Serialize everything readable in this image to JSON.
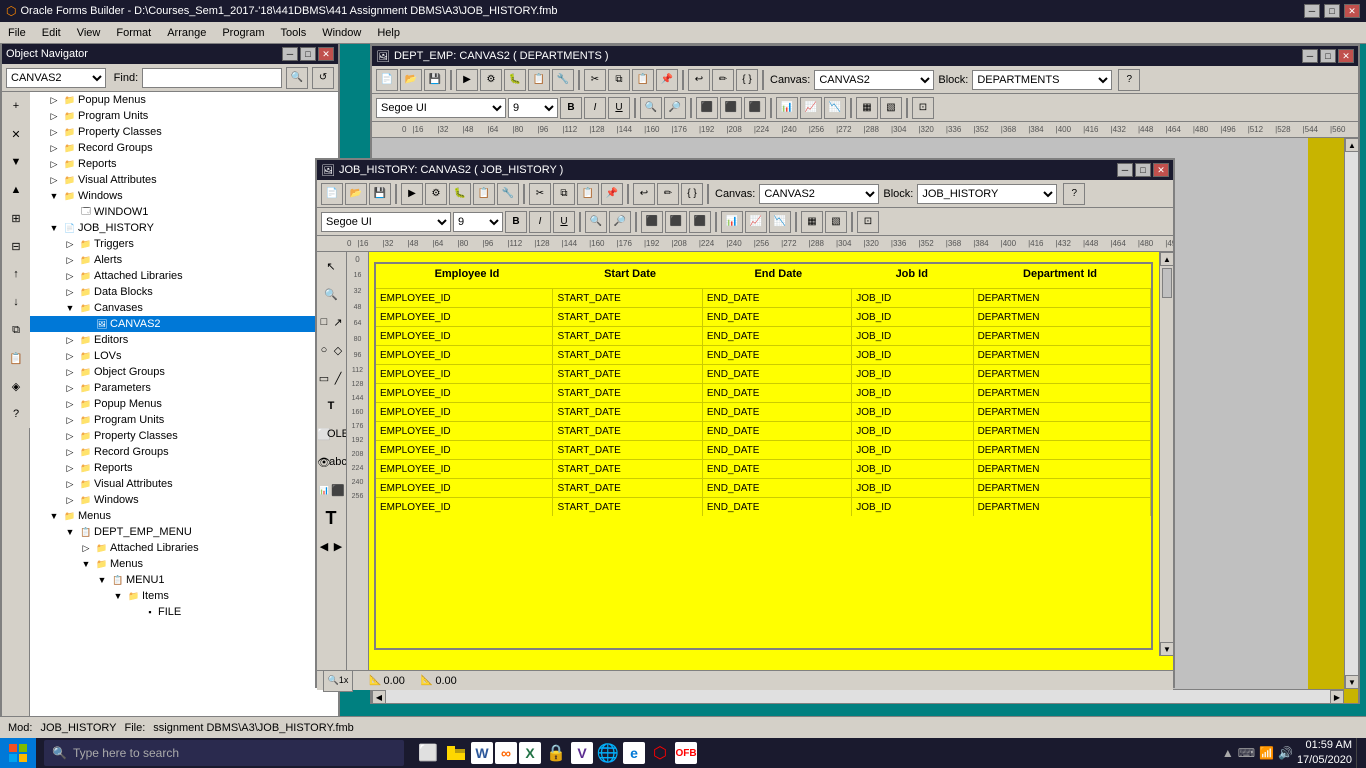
{
  "app": {
    "title": "Oracle Forms Builder - D:\\Courses_Sem1_2017-'18\\441DBMS\\441 Assignment DBMS\\A3\\JOB_HISTORY.fmb",
    "icon": "oracle-icon"
  },
  "menu": {
    "items": [
      "File",
      "Edit",
      "View",
      "Format",
      "Arrange",
      "Program",
      "Tools",
      "Window",
      "Help"
    ]
  },
  "object_navigator": {
    "title": "Object Navigator",
    "find_label": "Find:",
    "find_value": "CANVAS2",
    "tree_items": [
      {
        "label": "Popup Menus",
        "indent": 1,
        "type": "folder",
        "expanded": false
      },
      {
        "label": "Program Units",
        "indent": 1,
        "type": "folder",
        "expanded": false
      },
      {
        "label": "Property Classes",
        "indent": 1,
        "type": "folder",
        "expanded": false
      },
      {
        "label": "Record Groups",
        "indent": 1,
        "type": "folder",
        "expanded": false
      },
      {
        "label": "Reports",
        "indent": 1,
        "type": "folder",
        "expanded": false
      },
      {
        "label": "Visual Attributes",
        "indent": 1,
        "type": "folder",
        "expanded": false
      },
      {
        "label": "Windows",
        "indent": 1,
        "type": "folder",
        "expanded": true
      },
      {
        "label": "WINDOW1",
        "indent": 2,
        "type": "item"
      },
      {
        "label": "JOB_HISTORY",
        "indent": 1,
        "type": "folder",
        "expanded": true
      },
      {
        "label": "Triggers",
        "indent": 2,
        "type": "folder",
        "expanded": false
      },
      {
        "label": "Alerts",
        "indent": 2,
        "type": "folder",
        "expanded": false
      },
      {
        "label": "Attached Libraries",
        "indent": 2,
        "type": "folder",
        "expanded": false
      },
      {
        "label": "Data Blocks",
        "indent": 2,
        "type": "folder",
        "expanded": false
      },
      {
        "label": "Canvases",
        "indent": 2,
        "type": "folder",
        "expanded": true
      },
      {
        "label": "CANVAS2",
        "indent": 3,
        "type": "item",
        "selected": true
      },
      {
        "label": "Editors",
        "indent": 2,
        "type": "folder",
        "expanded": false
      },
      {
        "label": "LOVs",
        "indent": 2,
        "type": "folder",
        "expanded": false
      },
      {
        "label": "Object Groups",
        "indent": 2,
        "type": "folder",
        "expanded": false
      },
      {
        "label": "Parameters",
        "indent": 2,
        "type": "folder",
        "expanded": false
      },
      {
        "label": "Popup Menus",
        "indent": 2,
        "type": "folder",
        "expanded": false
      },
      {
        "label": "Program Units",
        "indent": 2,
        "type": "folder",
        "expanded": false
      },
      {
        "label": "Property Classes",
        "indent": 2,
        "type": "folder",
        "expanded": false
      },
      {
        "label": "Record Groups",
        "indent": 2,
        "type": "folder",
        "expanded": false
      },
      {
        "label": "Reports",
        "indent": 2,
        "type": "folder",
        "expanded": false
      },
      {
        "label": "Visual Attributes",
        "indent": 2,
        "type": "folder",
        "expanded": false
      },
      {
        "label": "Windows",
        "indent": 2,
        "type": "folder",
        "expanded": false
      },
      {
        "label": "Menus",
        "indent": 1,
        "type": "folder",
        "expanded": true
      },
      {
        "label": "DEPT_EMP_MENU",
        "indent": 2,
        "type": "folder",
        "expanded": true
      },
      {
        "label": "Attached Libraries",
        "indent": 3,
        "type": "folder",
        "expanded": false
      },
      {
        "label": "Menus",
        "indent": 3,
        "type": "folder",
        "expanded": true
      },
      {
        "label": "MENU1",
        "indent": 4,
        "type": "folder",
        "expanded": true
      },
      {
        "label": "Items",
        "indent": 5,
        "type": "folder",
        "expanded": true
      },
      {
        "label": "FILE",
        "indent": 6,
        "type": "item"
      }
    ]
  },
  "dept_canvas": {
    "title": "DEPT_EMP: CANVAS2 ( DEPARTMENTS )",
    "canvas_label": "Canvas:",
    "canvas_value": "CANVAS2",
    "block_label": "Block:",
    "block_value": "DEPARTMENTS",
    "font_name": "Segoe UI",
    "font_size": "9",
    "zoom": "1x",
    "pos_x": "0.00",
    "pos_y": "0.00"
  },
  "job_canvas": {
    "title": "JOB_HISTORY: CANVAS2 ( JOB_HISTORY )",
    "canvas_label": "Canvas:",
    "canvas_value": "CANVAS2",
    "block_label": "Block:",
    "block_value": "JOB_HISTORY",
    "font_name": "Segoe UI",
    "font_size": "9",
    "zoom": "1x",
    "pos_x": "0.00",
    "pos_y": "0.00",
    "columns": [
      "Employee Id",
      "Start Date",
      "End Date",
      "Job Id",
      "Department Id"
    ],
    "field_names": [
      "EMPLOYEE_ID",
      "START_DATE",
      "END_DATE",
      "JOB_ID",
      "DEPARTMEN"
    ],
    "rows": 12
  },
  "ruler_marks": [
    0,
    16,
    32,
    48,
    64,
    80,
    96,
    112,
    128,
    144,
    160,
    176,
    192,
    208,
    224,
    240,
    256,
    272,
    288,
    304,
    320,
    336,
    352,
    368,
    384,
    400,
    416,
    432,
    448,
    464,
    480,
    496,
    512,
    528,
    544,
    560
  ],
  "status_bar": {
    "mod_label": "Mod:",
    "mod_value": "JOB_HISTORY",
    "file_label": "File:",
    "file_value": "ssignment DBMS\\A3\\JOB_HISTORY.fmb"
  },
  "taskbar": {
    "search_placeholder": "Type here to search",
    "time": "01:59 AM",
    "date": "17/05/2020",
    "taskbar_items": [
      "explorer",
      "taskview",
      "word",
      "unknown1",
      "excel",
      "lock",
      "vs",
      "chrome",
      "unknown2",
      "browser",
      "unknown3",
      "unknown4"
    ]
  }
}
